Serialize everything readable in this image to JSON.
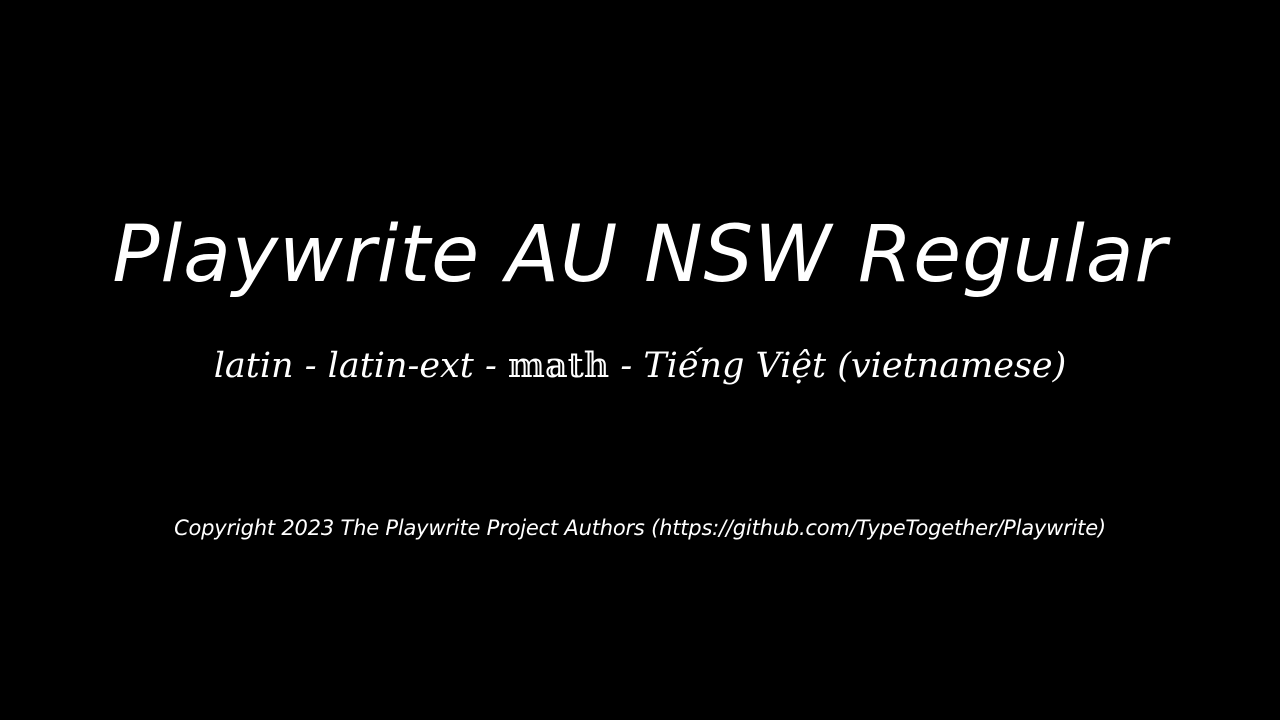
{
  "specimen": {
    "title": "Playwrite AU NSW Regular",
    "subtitle_prefix": "latin - latin-ext - ",
    "subtitle_math": "𝕞𝕒𝕥𝕙",
    "subtitle_suffix": " - Tiếng Việt (vietnamese)",
    "copyright": "Copyright 2023 The Playwrite Project Authors (https://github.com/TypeTogether/Playwrite)"
  },
  "colors": {
    "background": "#000000",
    "text": "#ffffff"
  }
}
